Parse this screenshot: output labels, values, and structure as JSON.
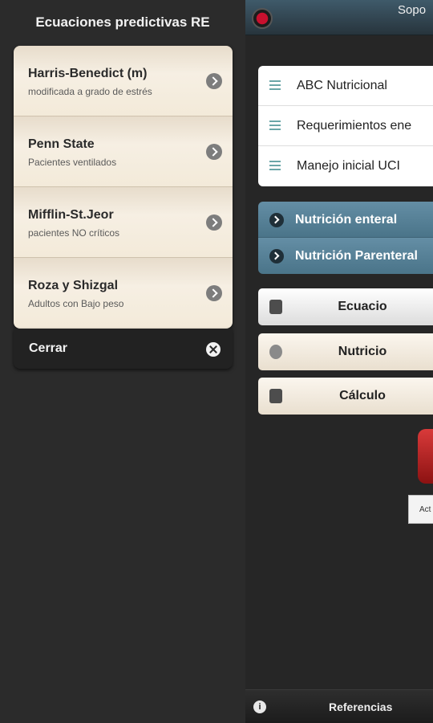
{
  "panel": {
    "title": "Ecuaciones predictivas RE",
    "equations": [
      {
        "name": "Harris-Benedict (m)",
        "subtitle": "modificada a grado de estrés"
      },
      {
        "name": "Penn State",
        "subtitle": "Pacientes ventilados"
      },
      {
        "name": "Mifflin-St.Jeor",
        "subtitle": "pacientes NO críticos"
      },
      {
        "name": "Roza y Shizgal",
        "subtitle": "Adultos con Bajo peso"
      }
    ],
    "close_label": "Cerrar"
  },
  "main": {
    "header_title": "Sopo",
    "menu": [
      {
        "label": "ABC Nutricional",
        "icon": "menu-icon"
      },
      {
        "label": "Requerimientos ene",
        "icon": "menu-icon"
      },
      {
        "label": "Manejo inicial UCI",
        "icon": "menu-icon"
      }
    ],
    "nav": [
      {
        "label": "Nutrición enteral",
        "icon": "chevron-right-icon"
      },
      {
        "label": "Nutrición Parenteral",
        "icon": "chevron-right-icon"
      }
    ],
    "buttons": [
      {
        "label": "Ecuacio",
        "icon": "calculator-icon"
      },
      {
        "label": "Nutricio",
        "icon": "pill-icon"
      },
      {
        "label": "Cálculo",
        "icon": "calculator-icon"
      }
    ],
    "act_label": "Act",
    "footer_label": "Referencias"
  },
  "colors": {
    "accent_blue": "#4a7489",
    "header": "#3f5a6a",
    "beige": "#f3ead9",
    "red": "#c8102e"
  }
}
